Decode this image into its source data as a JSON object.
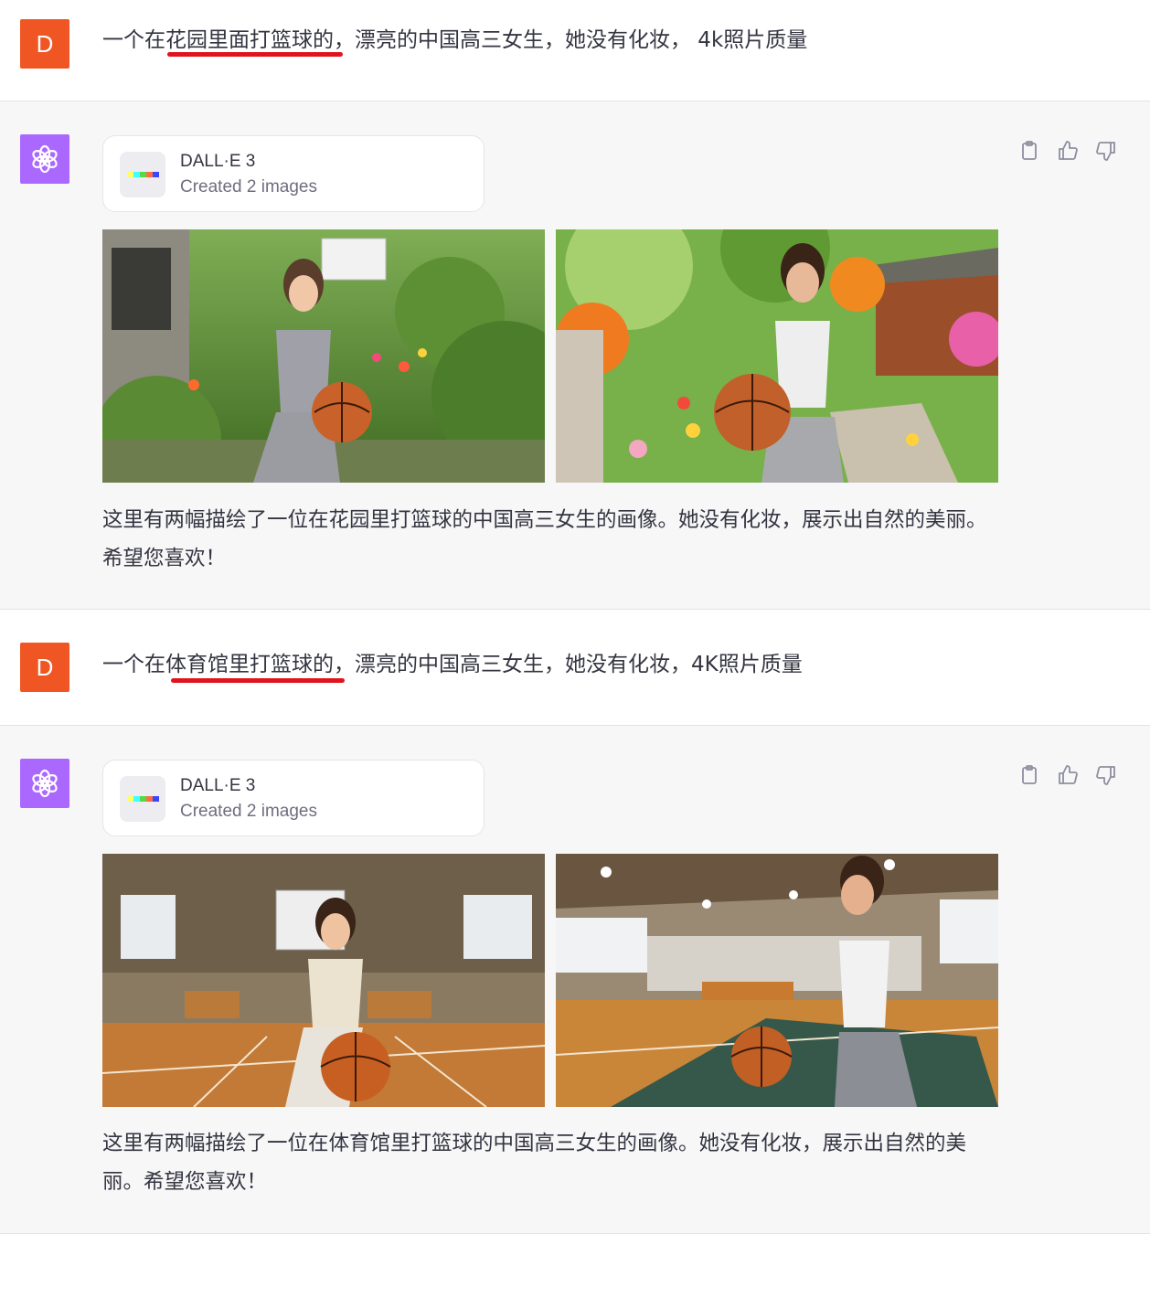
{
  "conversation": [
    {
      "role": "user",
      "avatar_letter": "D",
      "text": "一个在花园里面打篮球的，漂亮的中国高三女生，她没有化妆， 4k照片质量"
    },
    {
      "role": "assistant",
      "tool": {
        "name": "DALL·E 3",
        "subtitle": "Created 2 images"
      },
      "images": [
        {
          "label": "garden-basketball-image-1"
        },
        {
          "label": "garden-basketball-image-2"
        }
      ],
      "reply": "这里有两幅描绘了一位在花园里打篮球的中国高三女生的画像。她没有化妆，展示出自然的美丽。希望您喜欢！"
    },
    {
      "role": "user",
      "avatar_letter": "D",
      "text": "一个在体育馆里打篮球的，漂亮的中国高三女生，她没有化妆，4K照片质量"
    },
    {
      "role": "assistant",
      "tool": {
        "name": "DALL·E 3",
        "subtitle": "Created 2 images"
      },
      "images": [
        {
          "label": "gym-basketball-image-1"
        },
        {
          "label": "gym-basketball-image-2"
        }
      ],
      "reply": "这里有两幅描绘了一位在体育馆里打篮球的中国高三女生的画像。她没有化妆，展示出自然的美丽。希望您喜欢！"
    }
  ],
  "colors": {
    "user_avatar": "#f05623",
    "assistant_avatar": "#ab68ff",
    "annotation_underline": "#e0141e"
  },
  "icons": [
    "copy-icon",
    "thumbs-up-icon",
    "thumbs-down-icon",
    "openai-logo-icon"
  ]
}
